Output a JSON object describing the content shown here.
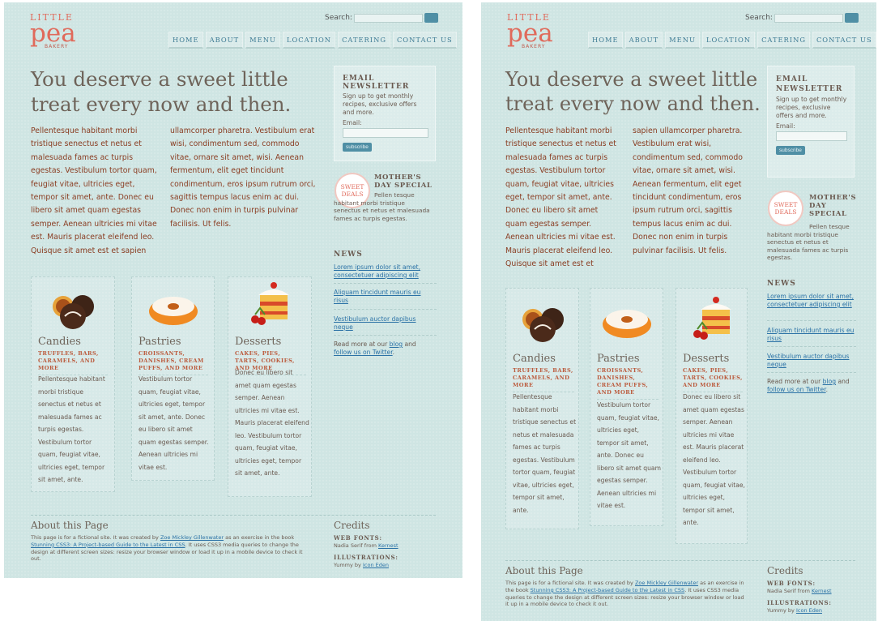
{
  "site": {
    "logo": {
      "line1": "LITTLE",
      "line2": "pea",
      "line3": "BAKERY"
    },
    "search": {
      "label": "Search:",
      "button": "Go"
    },
    "nav": [
      "HOME",
      "ABOUT",
      "MENU",
      "LOCATION",
      "CATERING",
      "CONTACT US"
    ],
    "headline_line1": "You deserve a sweet little",
    "headline_line2": "treat every now and then.",
    "intro_wide": {
      "col1": "Pellentesque habitant morbi tristique senectus et netus et malesuada fames ac turpis egestas. Vestibulum tortor quam, feugiat vitae, ultricies eget, tempor sit amet, ante. Donec eu libero sit amet quam egestas semper. Aenean ultricies mi vitae est. Mauris placerat eleifend leo. Quisque sit amet est et sapien",
      "col2": "ullamcorper pharetra. Vestibulum erat wisi, condimentum sed, commodo vitae, ornare sit amet, wisi. Aenean fermentum, elit eget tincidunt condimentum, eros ipsum rutrum orci, sagittis tempus lacus enim ac dui. Donec non enim in turpis pulvinar facilisis. Ut felis."
    },
    "intro_narrow": {
      "col1": "Pellentesque habitant morbi tristique senectus et netus et malesuada fames ac turpis egestas. Vestibulum tortor quam, feugiat vitae, ultricies eget, tempor sit amet, ante. Donec eu libero sit amet quam egestas semper. Aenean ultricies mi vitae est. Mauris placerat eleifend leo. Quisque sit amet est et",
      "col2": "sapien ullamcorper pharetra. Vestibulum erat wisi, condimentum sed, commodo vitae, ornare sit amet, wisi. Aenean fermentum, elit eget tincidunt condimentum, eros ipsum rutrum orci, sagittis tempus lacus enim ac dui. Donec non enim in turpis pulvinar facilisis. Ut felis."
    },
    "products": [
      {
        "title": "Candies",
        "subtitle": "TRUFFLES, BARS, CARAMELS, AND MORE",
        "body": "Pellentesque habitant morbi tristique senectus et netus et malesuada fames ac turpis egestas. Vestibulum tortor quam, feugiat vitae, ultricies eget, tempor sit amet, ante."
      },
      {
        "title": "Pastries",
        "subtitle": "CROISSANTS, DANISHES, CREAM PUFFS, AND MORE",
        "body": "Vestibulum tortor quam, feugiat vitae, ultricies eget, tempor sit amet, ante. Donec eu libero sit amet quam egestas semper. Aenean ultricies mi vitae est."
      },
      {
        "title": "Desserts",
        "subtitle": "CAKES, PIES, TARTS, COOKIES, AND MORE",
        "body": "Donec eu libero sit amet quam egestas semper. Aenean ultricies mi vitae est. Mauris placerat eleifend leo. Vestibulum tortor quam, feugiat vitae, ultricies eget, tempor sit amet, ante."
      }
    ],
    "newsletter": {
      "title": "EMAIL NEWSLETTER",
      "desc": "Sign up to get monthly recipes, exclusive offers and more.",
      "email_label": "Email:",
      "button": "subscribe"
    },
    "special": {
      "badge_line1": "SWEET",
      "badge_line2": "DEALS",
      "title": "MOTHER'S DAY SPECIAL",
      "text": "Pellen tesque habitant morbi tristique senectus et netus et malesuada fames ac turpis egestas."
    },
    "news": {
      "heading": "NEWS",
      "items": [
        "Lorem ipsum dolor sit amet, consectetuer adipiscing elit",
        "Aliquam tincidunt mauris eu risus",
        "Vestibulum auctor dapibus neque"
      ],
      "more_prefix": "Read more at our",
      "blog_link": "blog",
      "and": "and",
      "twitter_link": "follow us on Twitter",
      "suffix": "."
    },
    "about": {
      "title": "About this Page",
      "text1": "This page is for a fictional site. It was created by",
      "author": "Zoe Mickley Gillenwater",
      "text2": "as an exercise in the book",
      "book": "Stunning CSS3: A Project-based Guide to the Latest in CSS",
      "text3": ". It uses CSS3 media queries to change the design at different screen sizes: resize your browser window or load it up in a mobile device to check it out."
    },
    "credits": {
      "title": "Credits",
      "fonts_label": "WEB FONTS:",
      "fonts_text": "Nadia Serif from",
      "fonts_link": "Kernest",
      "illus_label": "ILLUSTRATIONS:",
      "illus_text": "Yummy by",
      "illus_link": "Icon Eden"
    }
  },
  "colors": {
    "page_bg": "#cfe5e3",
    "accent_coral": "#e06a5b",
    "nav_blue": "#3e7b94",
    "link_blue": "#2b72a6",
    "intro_rust": "#8a3d22"
  }
}
